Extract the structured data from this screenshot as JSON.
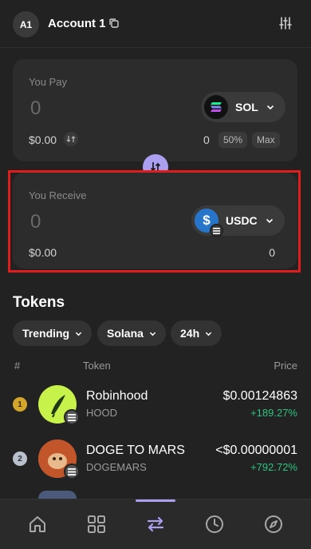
{
  "header": {
    "avatar_initials": "A1",
    "account_name": "Account 1"
  },
  "pay": {
    "label": "You Pay",
    "amount": "0",
    "usd_value": "$0.00",
    "token_symbol": "SOL",
    "balance": "0",
    "chip_half": "50%",
    "chip_max": "Max"
  },
  "receive": {
    "label": "You Receive",
    "amount": "0",
    "usd_value": "$0.00",
    "token_symbol": "USDC",
    "balance": "0"
  },
  "tokens": {
    "title": "Tokens",
    "filters": [
      "Trending",
      "Solana",
      "24h"
    ],
    "columns": {
      "rank": "#",
      "token": "Token",
      "price": "Price"
    },
    "rows": [
      {
        "rank": "1",
        "name": "Robinhood",
        "symbol": "HOOD",
        "price": "$0.00124863",
        "change": "+189.27%"
      },
      {
        "rank": "2",
        "name": "DOGE TO MARS",
        "symbol": "DOGEMARS",
        "price": "<$0.00000001",
        "change": "+792.72%"
      }
    ]
  },
  "colors": {
    "accent": "#ab9ff2",
    "highlight": "#e01c1c",
    "positive": "#2ec27e",
    "background": "#222222"
  },
  "nav": {
    "icons": [
      "home-icon",
      "grid-icon",
      "swap-icon",
      "history-icon",
      "explore-icon"
    ],
    "active": "swap-icon"
  }
}
